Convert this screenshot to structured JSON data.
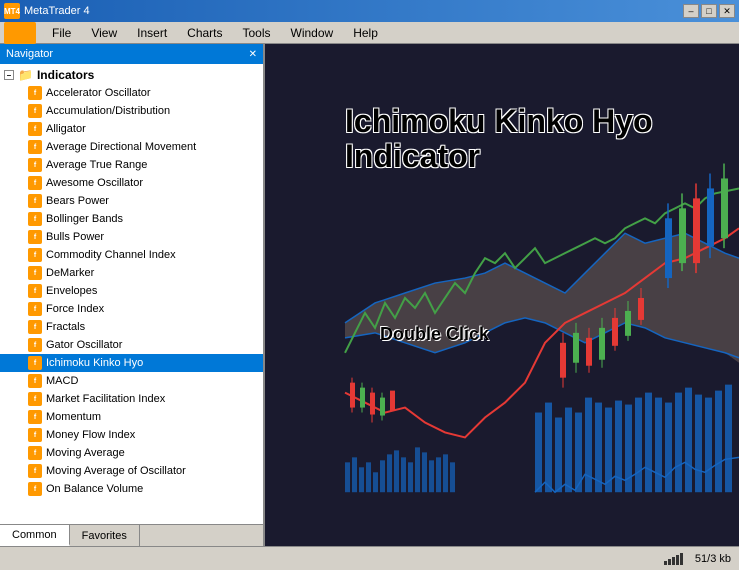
{
  "window": {
    "title": "MetaTrader 4",
    "icon_label": "MT4"
  },
  "title_controls": {
    "minimize": "–",
    "maximize": "□",
    "close": "✕"
  },
  "menu": {
    "items": [
      "File",
      "View",
      "Insert",
      "Charts",
      "Tools",
      "Window",
      "Help"
    ]
  },
  "navigator": {
    "title": "Navigator",
    "close_label": "✕",
    "root": {
      "label": "Indicators",
      "collapse": "–"
    },
    "items": [
      "Accelerator Oscillator",
      "Accumulation/Distribution",
      "Alligator",
      "Average Directional Movement",
      "Average True Range",
      "Awesome Oscillator",
      "Bears Power",
      "Bollinger Bands",
      "Bulls Power",
      "Commodity Channel Index",
      "DeMarker",
      "Envelopes",
      "Force Index",
      "Fractals",
      "Gator Oscillator",
      "Ichimoku Kinko Hyo",
      "MACD",
      "Market Facilitation Index",
      "Momentum",
      "Money Flow Index",
      "Moving Average",
      "Moving Average of Oscillator",
      "On Balance Volume"
    ],
    "selected_index": 15,
    "tabs": [
      "Common",
      "Favorites"
    ]
  },
  "chart": {
    "annotation_line1": "Ichimoku Kinko Hyo",
    "annotation_line2": "Indicator",
    "double_click_label": "Double Click",
    "background_color": "#1a1a2e"
  },
  "status_bar": {
    "info": "51/3 kb"
  }
}
